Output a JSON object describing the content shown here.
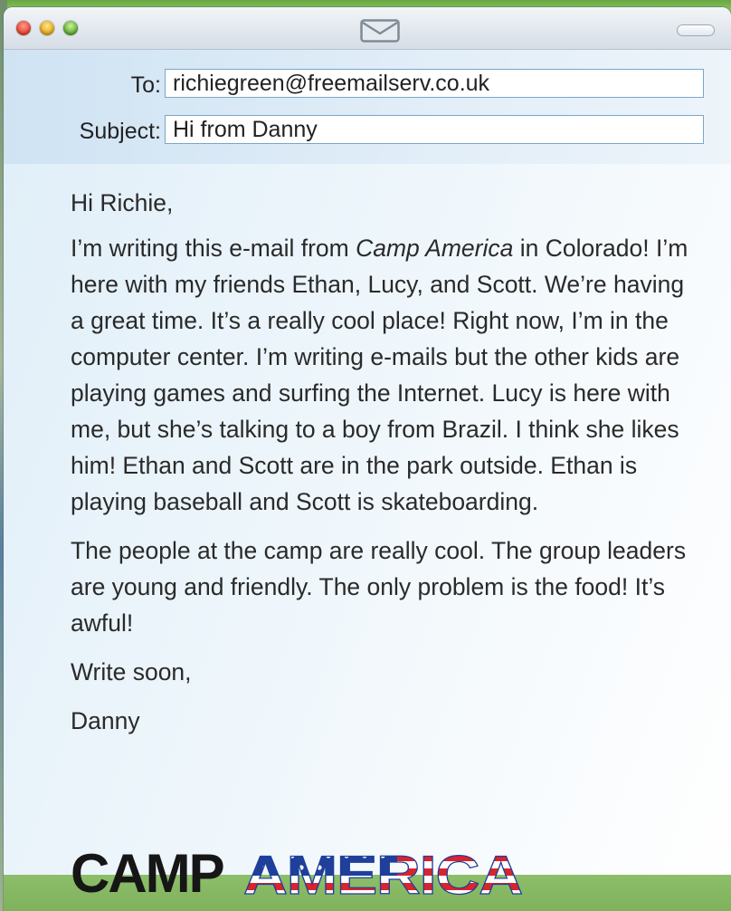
{
  "window": {
    "buttons": [
      "close",
      "minimize",
      "zoom"
    ],
    "title_icon": "envelope-icon"
  },
  "email": {
    "to_label": "To:",
    "to_value": "richiegreen@freemailserv.co.uk",
    "subject_label": "Subject:",
    "subject_value": "Hi from Danny"
  },
  "message": {
    "greeting": "Hi Richie,",
    "p1_a": "I’m writing this e-mail from ",
    "p1_em": "Camp America",
    "p1_b": " in Colorado! I’m here with my friends Ethan, Lucy, and Scott. We’re having a great time. It’s a really cool place! Right now, I’m in the computer center. I’m writing e-mails but the other kids are playing games and surfing the Internet. Lucy is here with me, but she’s talking to a boy from Brazil. I think she likes him! Ethan and Scott are in the park outside. Ethan is playing baseball and Scott is skateboarding.",
    "p2": "The people at the camp are really cool. The group leaders are young and friendly. The only problem is the food! It’s awful!",
    "closing": "Write soon,",
    "signature": "Danny"
  },
  "logo": {
    "word1": "CAMP",
    "word2": "AMERICA",
    "colors": {
      "red": "#d9232e",
      "blue": "#1f3f9a",
      "white": "#ffffff",
      "black": "#161616"
    }
  }
}
